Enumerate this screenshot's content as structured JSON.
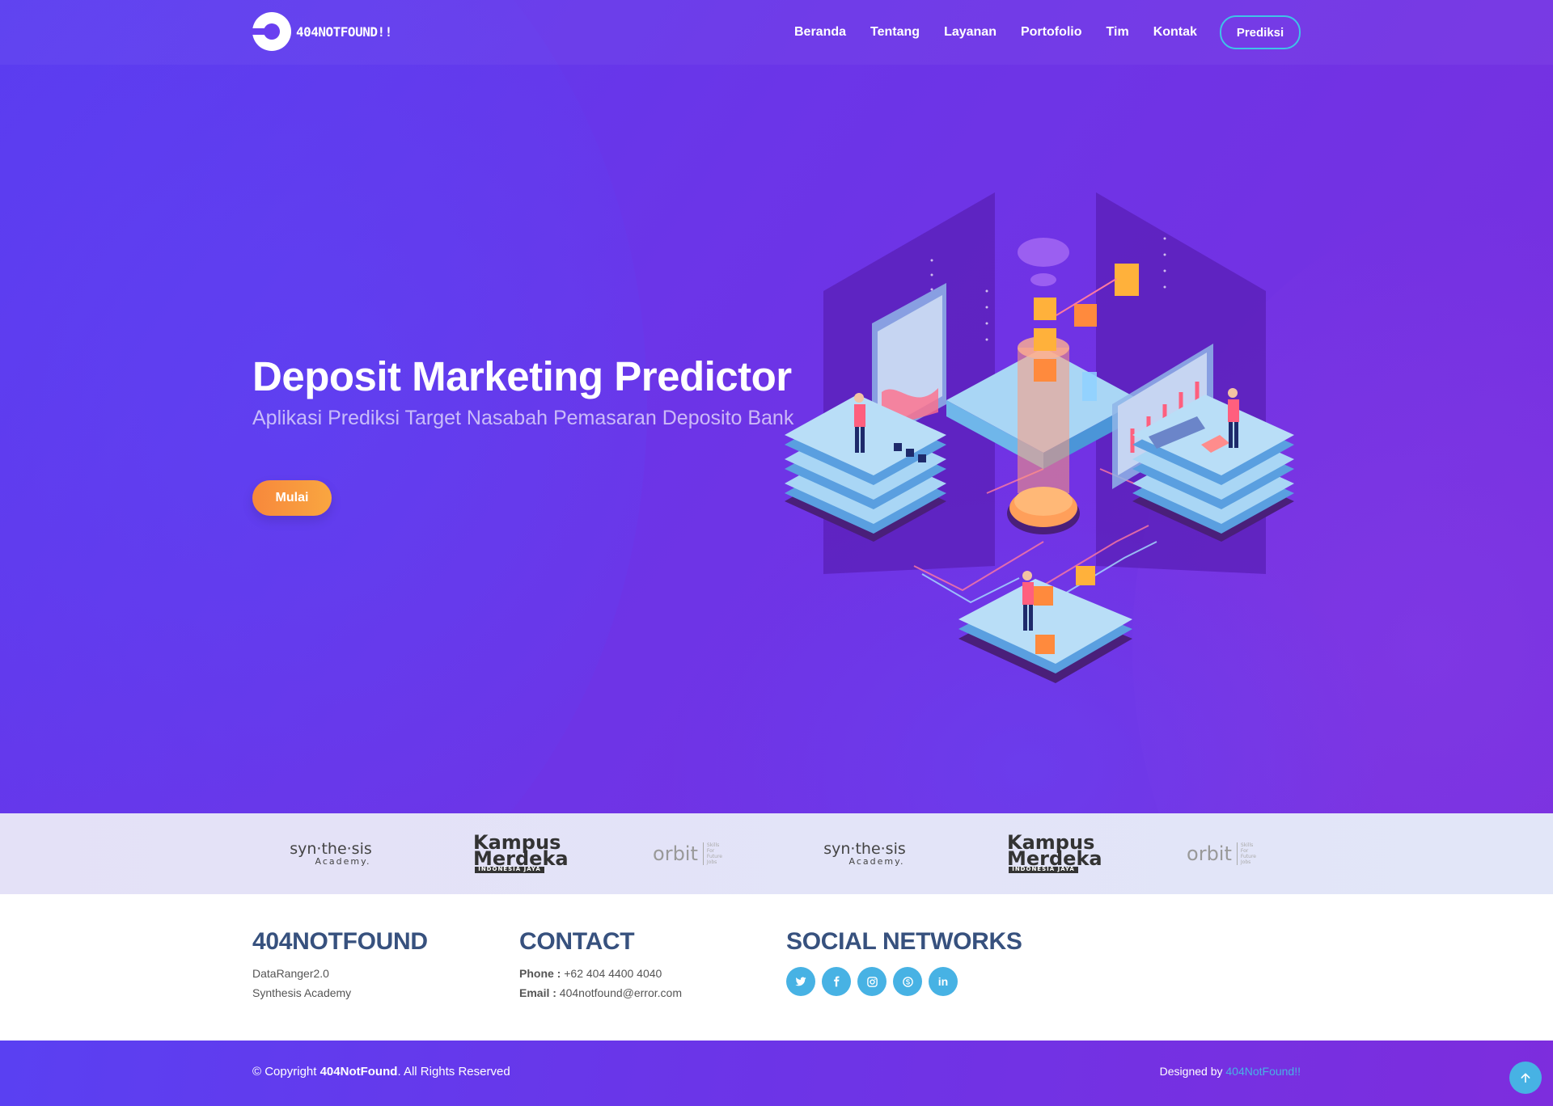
{
  "brand": {
    "logo_text": "404NOTFOUND!!"
  },
  "nav": {
    "items": [
      "Beranda",
      "Tentang",
      "Layanan",
      "Portofolio",
      "Tim",
      "Kontak"
    ],
    "cta": "Prediksi"
  },
  "hero": {
    "title": "Deposit Marketing Predictor",
    "subtitle": "Aplikasi Prediksi Target Nasabah Pemasaran Deposito Bank",
    "button": "Mulai"
  },
  "partners": [
    {
      "name": "syn·the·sis",
      "sub": "Academy."
    },
    {
      "name": "Kampus Merdeka",
      "sub": "INDONESIA JAYA"
    },
    {
      "name": "orbit",
      "sub": "Skills For Future Jobs"
    },
    {
      "name": "syn·the·sis",
      "sub": "Academy."
    },
    {
      "name": "Kampus Merdeka",
      "sub": "INDONESIA JAYA"
    },
    {
      "name": "orbit",
      "sub": "Skills For Future Jobs"
    }
  ],
  "footer": {
    "about": {
      "heading": "404NOTFOUND",
      "lines": [
        "DataRanger2.0",
        "Synthesis Academy"
      ]
    },
    "contact": {
      "heading": "CONTACT",
      "phone_label": "Phone :",
      "phone": "+62 404 4400 4040",
      "email_label": "Email :",
      "email": "404notfound@error.com"
    },
    "social": {
      "heading": "SOCIAL NETWORKS",
      "icons": [
        "twitter-icon",
        "facebook-icon",
        "instagram-icon",
        "skype-icon",
        "linkedin-icon"
      ]
    }
  },
  "bottom": {
    "copyright_prefix": "© Copyright",
    "copyright_brand": "404NotFound",
    "copyright_suffix": ". All Rights Reserved",
    "designed_prefix": "Designed by",
    "designed_link": "404NotFound!!"
  },
  "colors": {
    "accent": "#47b2e4",
    "hero": "#6a3ff0",
    "button": "#f7883c",
    "heading": "#37517e"
  }
}
